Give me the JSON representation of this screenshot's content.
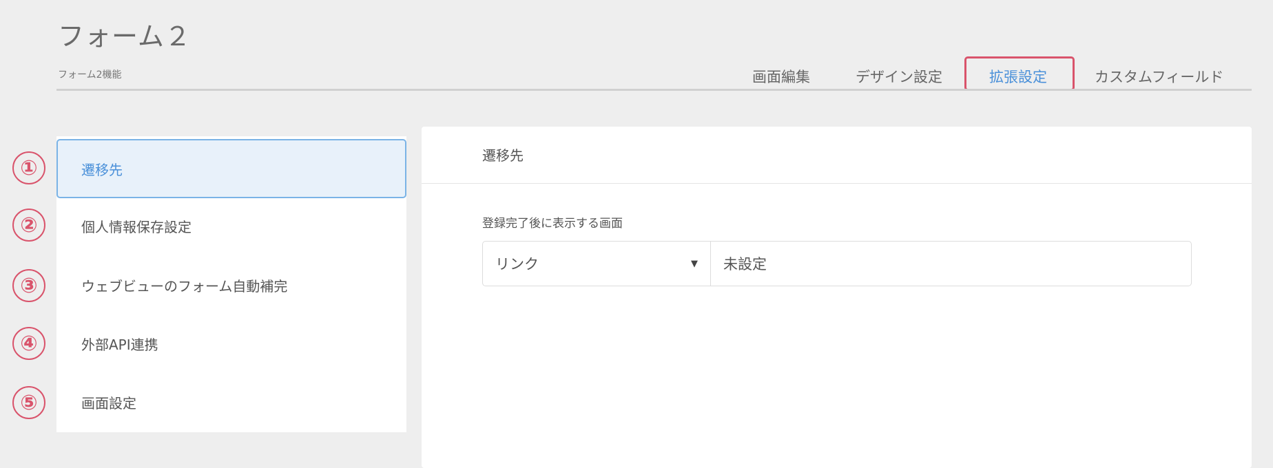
{
  "header": {
    "title": "フォーム２",
    "subtitle": "フォーム2機能"
  },
  "tabs": [
    {
      "label": "画面編集",
      "active": false
    },
    {
      "label": "デザイン設定",
      "active": false
    },
    {
      "label": "拡張設定",
      "active": true
    },
    {
      "label": "カスタムフィールド",
      "active": false
    }
  ],
  "sidebar": {
    "items": [
      {
        "label": "遷移先",
        "active": true
      },
      {
        "label": "個人情報保存設定",
        "active": false
      },
      {
        "label": "ウェブビューのフォーム自動補完",
        "active": false
      },
      {
        "label": "外部API連携",
        "active": false
      },
      {
        "label": "画面設定",
        "active": false
      }
    ]
  },
  "annotations": {
    "numbers": [
      "①",
      "②",
      "③",
      "④",
      "⑤"
    ],
    "color": "#d9536b"
  },
  "panel": {
    "title": "遷移先",
    "field_label": "登録完了後に表示する画面",
    "select_value": "リンク",
    "link_value": "未設定"
  },
  "colors": {
    "accent": "#4a90d9",
    "highlight": "#d9536b",
    "background": "#eeeeee"
  }
}
